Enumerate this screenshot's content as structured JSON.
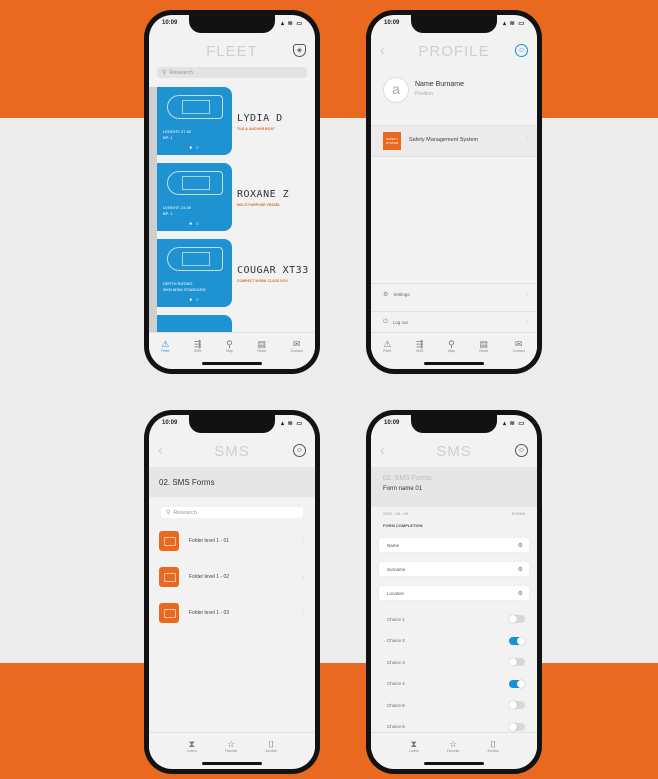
{
  "colors": {
    "brand": "#e8691f",
    "accent": "#1a8fd8"
  },
  "status_time": "10:09",
  "fleet": {
    "title": "FLEET",
    "search_placeholder": "Research",
    "vessels": [
      {
        "name": "LYDIA D",
        "subtitle": "TUG & ANCHOR BOAT",
        "spec": "LENGHT: 27.92\nBP: 1"
      },
      {
        "name": "ROXANE Z",
        "subtitle": "MULTI PURPOSE VESSEL",
        "spec": "LENGHT: 24.00\nBP: 1"
      },
      {
        "name": "COUGAR XT33",
        "subtitle": "COMPACT WORK CLASS ROV",
        "spec": "DEPTH RATING\n3000 MSW STANDARD"
      }
    ],
    "tabs": [
      "Fleet",
      "SMS",
      "Map",
      "News",
      "Contact"
    ]
  },
  "profile": {
    "title": "PROFILE",
    "name": "Name Burname",
    "role": "Position",
    "avatar_letter": "a",
    "sms_badge": "SAFETY SYSTEM",
    "sms_label": "Safety Management System",
    "settings": "Settings",
    "logout": "Log out",
    "tabs": [
      "Fleet",
      "SMS",
      "Map",
      "News",
      "Contact"
    ]
  },
  "sms": {
    "title": "SMS",
    "section": "02. SMS Forms",
    "search_placeholder": "Research",
    "folders": [
      "Folder level 1 - 01",
      "Folder level 1 - 02",
      "Folder level 1 - 03"
    ],
    "tabs": [
      "Lorem",
      "Favorite",
      "Archive"
    ]
  },
  "form": {
    "title": "SMS",
    "section": "02. SMS Forms",
    "form_name": "Form name 01",
    "date": "2022 - 05 - 09",
    "code": "N°0000",
    "completion": "FORM COMPLETION",
    "fields": [
      "Name",
      "Surname",
      "Location"
    ],
    "choices": [
      {
        "label": "Choice 1",
        "on": false
      },
      {
        "label": "Choice 2",
        "on": true
      },
      {
        "label": "Choice 3",
        "on": false
      },
      {
        "label": "Choice 4",
        "on": true
      },
      {
        "label": "Choice 5",
        "on": false
      },
      {
        "label": "Choice 6",
        "on": false
      }
    ],
    "tabs": [
      "Lorem",
      "Favorite",
      "Archive"
    ]
  }
}
